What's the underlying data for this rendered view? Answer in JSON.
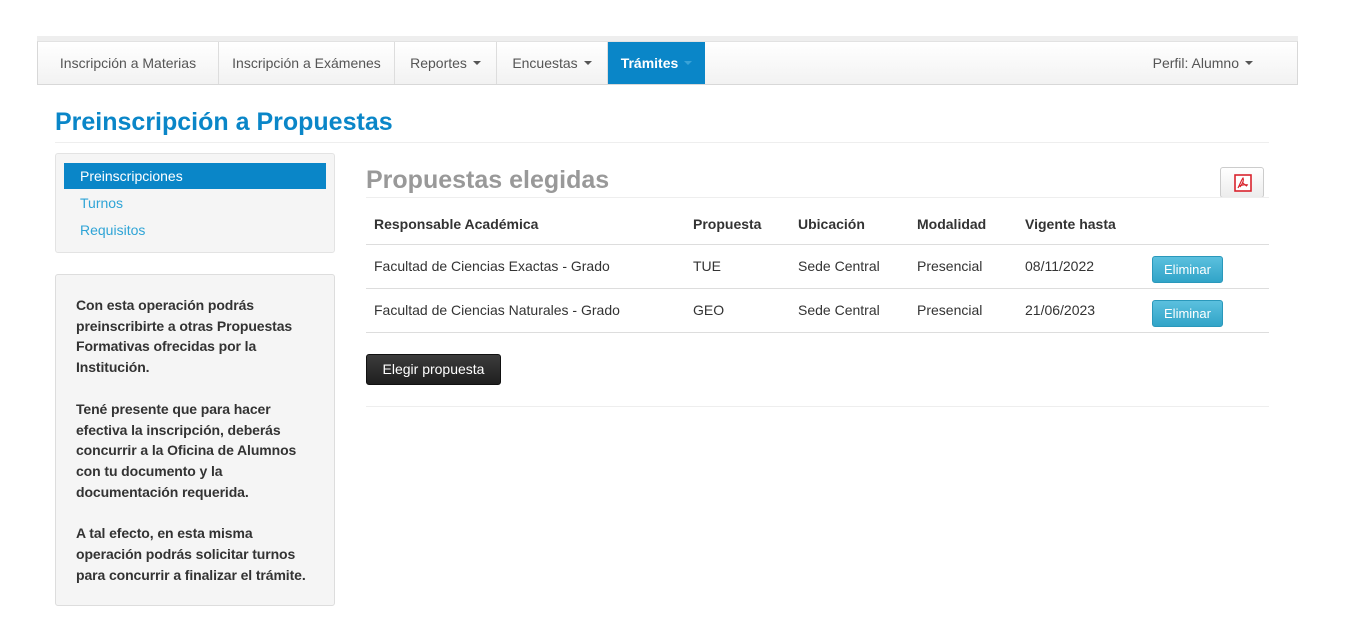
{
  "nav": {
    "items": [
      {
        "label": "Inscripción a Materias",
        "dropdown": false,
        "active": false
      },
      {
        "label": "Inscripción a Exámenes",
        "dropdown": false,
        "active": false
      },
      {
        "label": "Reportes",
        "dropdown": true,
        "active": false
      },
      {
        "label": "Encuestas",
        "dropdown": true,
        "active": false
      },
      {
        "label": "Trámites",
        "dropdown": true,
        "active": true
      }
    ],
    "profile": "Perfil: Alumno"
  },
  "page": {
    "title": "Preinscripción a Propuestas"
  },
  "sidebar": {
    "items": [
      {
        "label": "Preinscripciones",
        "active": true
      },
      {
        "label": "Turnos",
        "active": false
      },
      {
        "label": "Requisitos",
        "active": false
      }
    ],
    "info": [
      "Con esta operación podrás preinscribirte a otras Propuestas Formativas ofrecidas por la Institución.",
      "Tené presente que para hacer efectiva la inscripción, deberás concurrir a la Oficina de Alumnos con tu documento y la documentación requerida.",
      "A tal efecto, en esta misma operación podrás solicitar turnos para concurrir a finalizar el trámite."
    ]
  },
  "main": {
    "section_title": "Propuestas elegidas",
    "pdf_icon": "pdf-icon",
    "columns": [
      "Responsable Académica",
      "Propuesta",
      "Ubicación",
      "Modalidad",
      "Vigente hasta"
    ],
    "rows": [
      {
        "responsable": "Facultad de Ciencias Exactas - Grado",
        "propuesta": "TUE",
        "ubicacion": "Sede Central",
        "modalidad": "Presencial",
        "vigente": "08/11/2022",
        "action": "Eliminar"
      },
      {
        "responsable": "Facultad de Ciencias Naturales - Grado",
        "propuesta": "GEO",
        "ubicacion": "Sede Central",
        "modalidad": "Presencial",
        "vigente": "21/06/2023",
        "action": "Eliminar"
      }
    ],
    "choose_button": "Elegir propuesta"
  },
  "colors": {
    "accent": "#0a86c8",
    "link": "#2fa4d6",
    "info_button": "#5bc0de",
    "dark_button": "#2b2b2b"
  }
}
